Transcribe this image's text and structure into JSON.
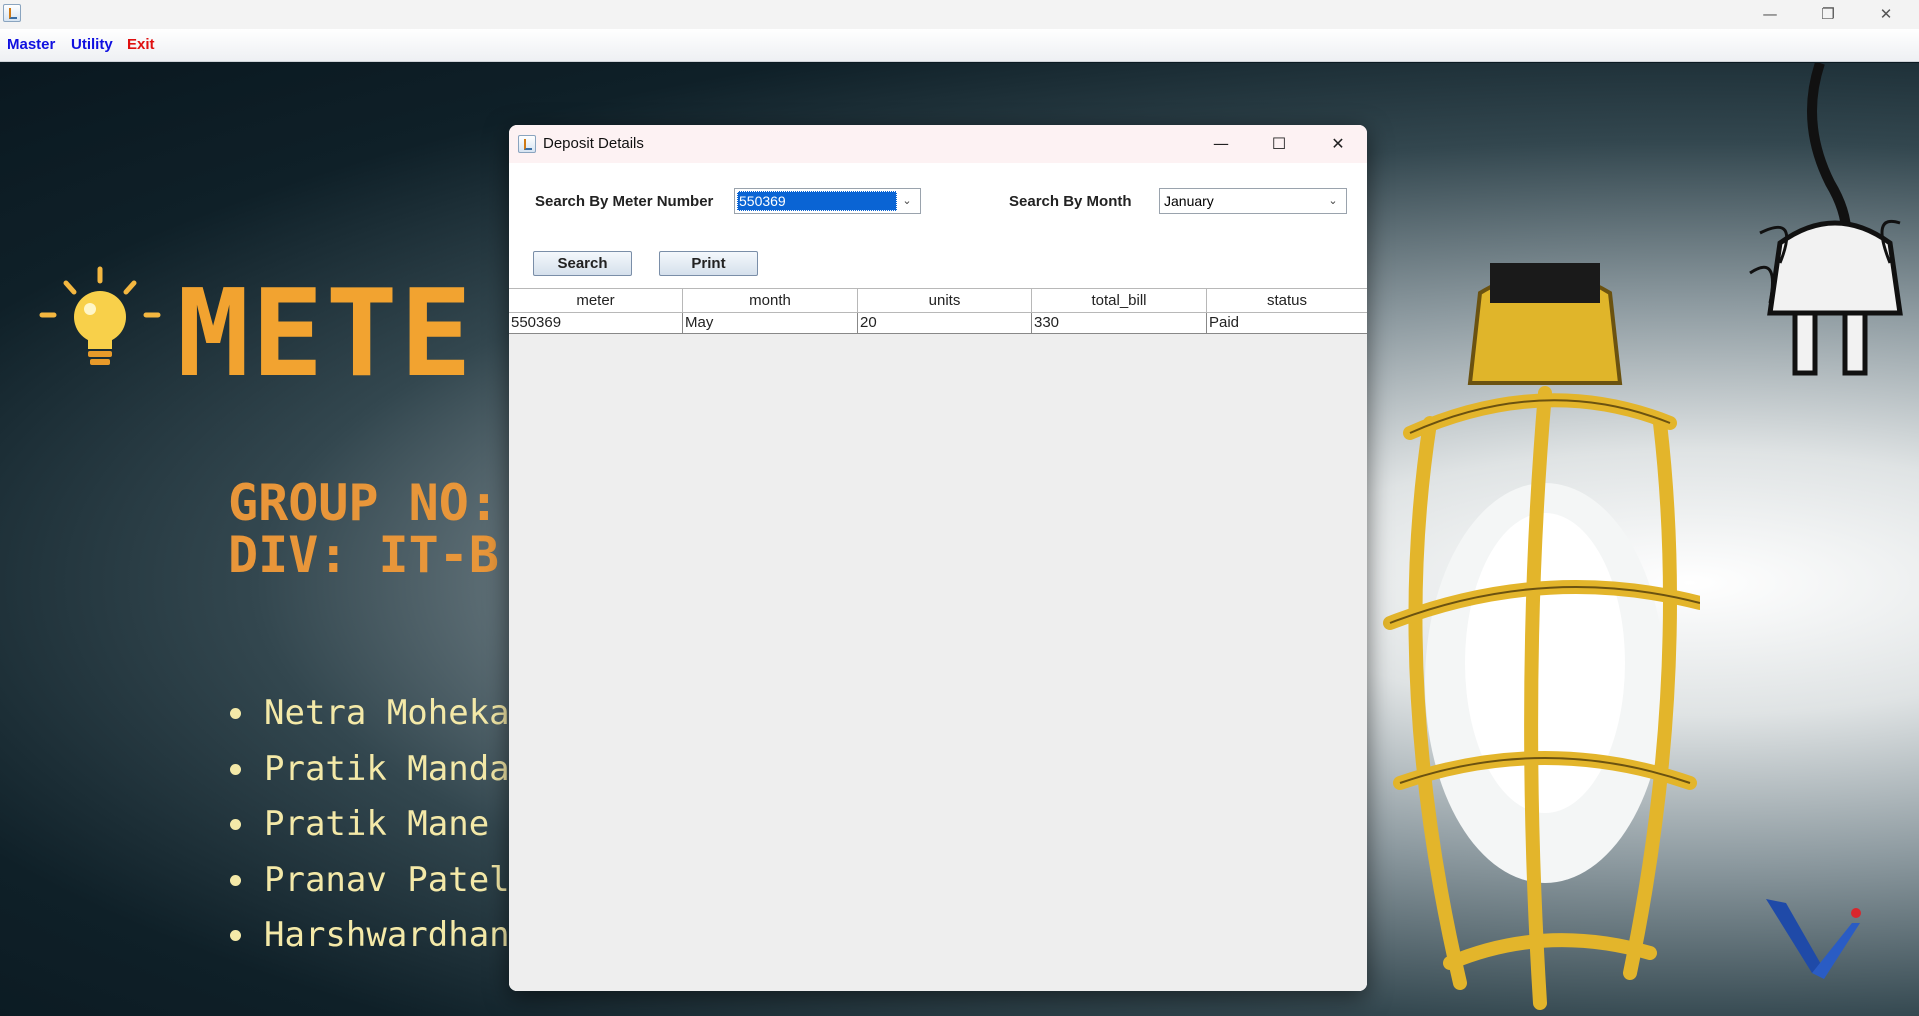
{
  "app": {
    "window_controls": {
      "minimize": "—",
      "restore": "❐",
      "close": "✕"
    },
    "menu": {
      "master": "Master",
      "utility": "Utility",
      "exit": "Exit"
    }
  },
  "slide": {
    "title": "METE",
    "group_line": "GROUP NO:",
    "div_line": "DIV: IT-B",
    "members": [
      "Netra Mohekar",
      "Pratik Mandalk",
      "Pratik Mane",
      "Pranav Patel",
      "Harshwardhan"
    ],
    "accent_color": "#f2a330",
    "member_color": "#f4e9a8"
  },
  "dialog": {
    "title": "Deposit Details",
    "controls": {
      "minimize": "—",
      "maximize": "☐",
      "close": "✕"
    },
    "search_meter_label": "Search By Meter Number",
    "meter_value": "550369",
    "search_month_label": "Search By Month",
    "month_value": "January",
    "search_button": "Search",
    "print_button": "Print",
    "table": {
      "columns": [
        "meter",
        "month",
        "units",
        "total_bill",
        "status"
      ],
      "rows": [
        [
          "550369",
          "May",
          "20",
          "330",
          "Paid"
        ]
      ]
    }
  }
}
